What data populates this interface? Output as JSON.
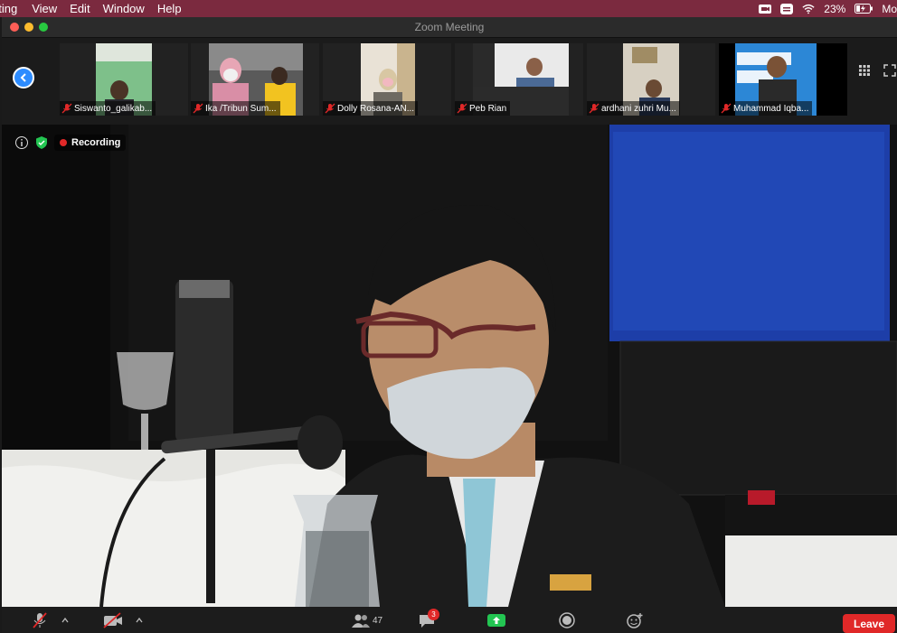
{
  "menubar": {
    "items": [
      "eting",
      "View",
      "Edit",
      "Window",
      "Help"
    ],
    "battery": "23%",
    "user": "Mo"
  },
  "window": {
    "title": "Zoom Meeting"
  },
  "gallery": {
    "participants": [
      {
        "name": "Siswanto_galikab..."
      },
      {
        "name": "Ika /Tribun Sum..."
      },
      {
        "name": "Dolly Rosana-AN..."
      },
      {
        "name": "Peb Rian"
      },
      {
        "name": "ardhani zuhri Mu..."
      },
      {
        "name": "Muhammad Iqba..."
      }
    ]
  },
  "status": {
    "recording": "Recording"
  },
  "toolbar": {
    "participants_count": "47",
    "chat_badge": "3",
    "leave_label": "Leave"
  },
  "colors": {
    "accent": "#2d8cff",
    "danger": "#e02828",
    "share": "#23c552",
    "menubar": "#7b2a3f"
  }
}
